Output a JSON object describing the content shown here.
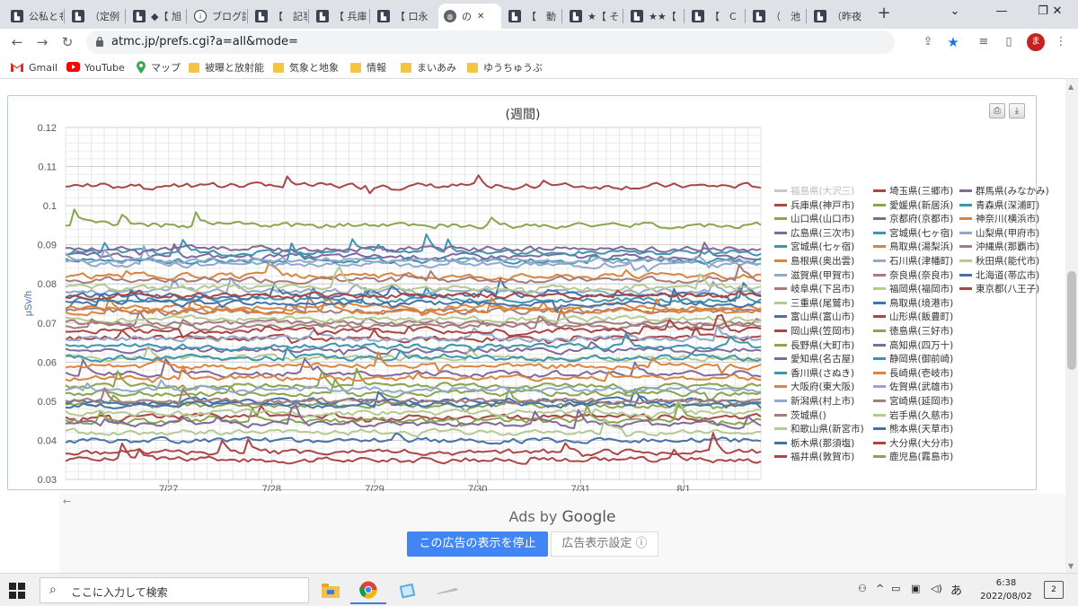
{
  "browser": {
    "tabs": [
      {
        "label": "公私とも",
        "icon": "site-favicon"
      },
      {
        "label": "（定例",
        "icon": "site-favicon"
      },
      {
        "label": "◆【 旭",
        "icon": "site-favicon"
      },
      {
        "label": "ブログ記",
        "icon": "info-favicon"
      },
      {
        "label": "【　記事",
        "icon": "site-favicon"
      },
      {
        "label": "【 兵庫",
        "icon": "site-favicon"
      },
      {
        "label": "【 口永",
        "icon": "site-favicon"
      },
      {
        "label": "の",
        "icon": "globe-favicon",
        "active": true
      },
      {
        "label": "【　動",
        "icon": "site-favicon"
      },
      {
        "label": "★【 そ",
        "icon": "site-favicon"
      },
      {
        "label": "★★【",
        "icon": "site-favicon"
      },
      {
        "label": "【　C",
        "icon": "site-favicon"
      },
      {
        "label": "（　池",
        "icon": "site-favicon"
      },
      {
        "label": "（昨夜",
        "icon": "site-favicon"
      }
    ],
    "url": "atmc.jp/prefs.cgi?a=all&mode=",
    "avatar_letter": "ま",
    "bookmarks": [
      {
        "label": "Gmail",
        "icon": "gmail-icon"
      },
      {
        "label": "YouTube",
        "icon": "youtube-icon"
      },
      {
        "label": "マップ",
        "icon": "maps-icon"
      },
      {
        "label": "被曝と放射能",
        "icon": "folder-icon"
      },
      {
        "label": "気象と地象",
        "icon": "folder-icon"
      },
      {
        "label": "情報",
        "icon": "folder-icon"
      },
      {
        "label": "まいあみ",
        "icon": "folder-icon"
      },
      {
        "label": "ゆうちゅうぶ",
        "icon": "folder-icon"
      }
    ]
  },
  "chart_data": {
    "type": "line",
    "title": "(週間)",
    "ylabel": "μSv/h",
    "xlabel": "",
    "ylim": [
      0.03,
      0.12
    ],
    "yticks": [
      "0.03",
      "0.04",
      "0.05",
      "0.06",
      "0.07",
      "0.08",
      "0.09",
      "0.1",
      "0.11",
      "0.12"
    ],
    "x_tick_labels": [
      "7/27",
      "7/28",
      "7/29",
      "7/30",
      "7/31",
      "8/1"
    ],
    "x_tick_days": [
      1,
      2,
      3,
      4,
      5,
      6
    ],
    "x_range_days": [
      0,
      6.75
    ],
    "grid": true,
    "legend_position": "right",
    "series": [
      {
        "name": "福島県(大沢三)",
        "color": "#c8c8c8",
        "base": null
      },
      {
        "name": "兵庫県(神戸市)",
        "color": "#aa4643",
        "base": 0.046
      },
      {
        "name": "山口県(山口市)",
        "color": "#89a54e",
        "base": 0.049
      },
      {
        "name": "広島県(三次市)",
        "color": "#80699b",
        "base": 0.063
      },
      {
        "name": "宮城県(七ヶ宿)",
        "color": "#3d96ae",
        "base": 0.076
      },
      {
        "name": "島根県(奥出雲)",
        "color": "#db843d",
        "base": 0.082
      },
      {
        "name": "滋賀県(甲賀市)",
        "color": "#92a8cd",
        "base": 0.078
      },
      {
        "name": "岐阜県(下呂市)",
        "color": "#a47d7c",
        "base": 0.07
      },
      {
        "name": "三重県(尾鷲市)",
        "color": "#b5ca92",
        "base": 0.061
      },
      {
        "name": "富山県(富山市)",
        "color": "#4572a7",
        "base": 0.05
      },
      {
        "name": "岡山県(笠岡市)",
        "color": "#aa4643",
        "base": 0.066
      },
      {
        "name": "長野県(大町市)",
        "color": "#89a54e",
        "base": 0.052
      },
      {
        "name": "愛知県(名古屋)",
        "color": "#80699b",
        "base": 0.057
      },
      {
        "name": "香川県(さぬき)",
        "color": "#3d96ae",
        "base": 0.061
      },
      {
        "name": "大阪府(東大阪)",
        "color": "#db843d",
        "base": 0.059
      },
      {
        "name": "新潟県(村上市)",
        "color": "#92a8cd",
        "base": 0.066
      },
      {
        "name": "茨城県()",
        "color": "#a47d7c",
        "base": 0.073
      },
      {
        "name": "和歌山県(新宮市)",
        "color": "#b5ca92",
        "base": 0.071
      },
      {
        "name": "栃木県(那須塩)",
        "color": "#4572a7",
        "base": 0.049
      },
      {
        "name": "福井県(敦賀市)",
        "color": "#aa4643",
        "base": 0.035
      },
      {
        "name": "埼玉県(三郷市)",
        "color": "#aa4643",
        "base": 0.105
      },
      {
        "name": "愛媛県(新居浜)",
        "color": "#89a54e",
        "base": 0.045
      },
      {
        "name": "京都府(京都市)",
        "color": "#80699b",
        "base": 0.087
      },
      {
        "name": "宮城県(七ヶ宿)",
        "color": "#3d96ae",
        "base": 0.088
      },
      {
        "name": "鳥取県(湯梨浜)",
        "color": "#db843d",
        "base": 0.073
      },
      {
        "name": "石川県(津幡町)",
        "color": "#92a8cd",
        "base": 0.085
      },
      {
        "name": "奈良県(奈良市)",
        "color": "#a47d7c",
        "base": 0.069
      },
      {
        "name": "福岡県(福岡市)",
        "color": "#b5ca92",
        "base": 0.047
      },
      {
        "name": "鳥取県(境港市)",
        "color": "#4572a7",
        "base": 0.077
      },
      {
        "name": "山形県(飯豊町)",
        "color": "#aa4643",
        "base": 0.068
      },
      {
        "name": "徳島県(三好市)",
        "color": "#89a54e",
        "base": 0.054
      },
      {
        "name": "高知県(四万十)",
        "color": "#80699b",
        "base": 0.044
      },
      {
        "name": "静岡県(御前崎)",
        "color": "#3d96ae",
        "base": 0.064
      },
      {
        "name": "長崎県(壱岐市)",
        "color": "#db843d",
        "base": 0.056
      },
      {
        "name": "佐賀県(武雄市)",
        "color": "#92a8cd",
        "base": 0.053
      },
      {
        "name": "宮崎県(延岡市)",
        "color": "#a47d7c",
        "base": 0.05
      },
      {
        "name": "岩手県(久慈市)",
        "color": "#b5ca92",
        "base": 0.042
      },
      {
        "name": "熊本県(天草市)",
        "color": "#4572a7",
        "base": 0.04
      },
      {
        "name": "大分県(大分市)",
        "color": "#aa4643",
        "base": 0.037
      },
      {
        "name": "鹿児島(霧島市)",
        "color": "#89a54e",
        "base": 0.095
      },
      {
        "name": "群馬県(みなかみ)",
        "color": "#80699b",
        "base": 0.089
      },
      {
        "name": "青森県(深浦町)",
        "color": "#3d96ae",
        "base": 0.086
      },
      {
        "name": "神奈川(横浜市)",
        "color": "#db843d",
        "base": 0.074
      },
      {
        "name": "山梨県(甲府市)",
        "color": "#92a8cd",
        "base": 0.086
      },
      {
        "name": "沖縄県(那覇市)",
        "color": "#a47d7c",
        "base": 0.081
      },
      {
        "name": "秋田県(能代市)",
        "color": "#b5ca92",
        "base": 0.079
      },
      {
        "name": "北海道(帯広市)",
        "color": "#4572a7",
        "base": 0.075
      },
      {
        "name": "東京都(八王子)",
        "color": "#aa4643",
        "base": 0.077
      }
    ]
  },
  "ads": {
    "ads_by": "Ads by",
    "google": "Google",
    "stop_label": "この広告の表示を停止",
    "settings_label": "広告表示設定 ⓘ"
  },
  "taskbar": {
    "search_placeholder": "ここに入力して検索",
    "ime": "あ",
    "time": "6:38",
    "date": "2022/08/02",
    "notif_count": "2"
  }
}
